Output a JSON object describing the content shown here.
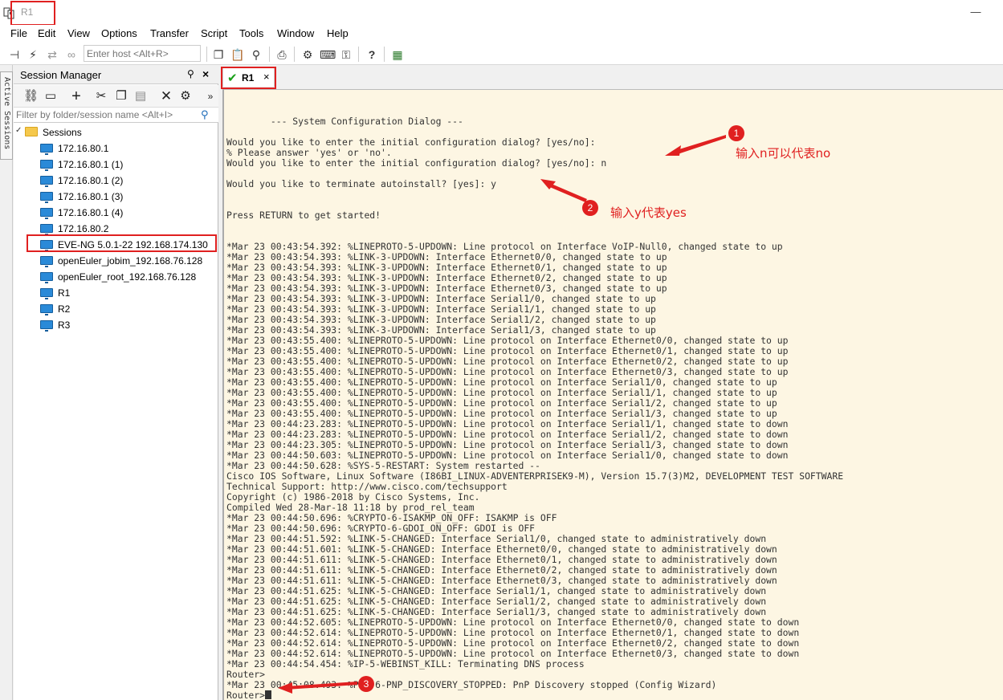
{
  "window": {
    "title": "R1",
    "minimize_glyph": "—"
  },
  "menu": [
    "File",
    "Edit",
    "View",
    "Options",
    "Transfer",
    "Script",
    "Tools",
    "Window",
    "Help"
  ],
  "toolbar": {
    "host_placeholder": "Enter host <Alt+R>"
  },
  "side_strip": {
    "label": "Active Sessions"
  },
  "session_manager": {
    "title": "Session Manager",
    "filter_placeholder": "Filter by folder/session name <Alt+I>",
    "folder": "Sessions",
    "sessions": [
      "172.16.80.1",
      "172.16.80.1 (1)",
      "172.16.80.1 (2)",
      "172.16.80.1 (3)",
      "172.16.80.1 (4)",
      "172.16.80.2",
      "EVE-NG 5.0.1-22 192.168.174.130",
      "openEuler_jobim_192.168.76.128",
      "openEuler_root_192.168.76.128",
      "R1",
      "R2",
      "R3"
    ],
    "selected_session": "EVE-NG 5.0.1-22 192.168.174.130"
  },
  "tab": {
    "label": "R1",
    "status_icon": "check-icon",
    "close_glyph": "×"
  },
  "terminal": {
    "lines": [
      "",
      "        --- System Configuration Dialog ---",
      "",
      "Would you like to enter the initial configuration dialog? [yes/no]:",
      "% Please answer 'yes' or 'no'.",
      "Would you like to enter the initial configuration dialog? [yes/no]: n",
      "",
      "Would you like to terminate autoinstall? [yes]: y",
      "",
      "",
      "Press RETURN to get started!",
      "",
      "",
      "*Mar 23 00:43:54.392: %LINEPROTO-5-UPDOWN: Line protocol on Interface VoIP-Null0, changed state to up",
      "*Mar 23 00:43:54.393: %LINK-3-UPDOWN: Interface Ethernet0/0, changed state to up",
      "*Mar 23 00:43:54.393: %LINK-3-UPDOWN: Interface Ethernet0/1, changed state to up",
      "*Mar 23 00:43:54.393: %LINK-3-UPDOWN: Interface Ethernet0/2, changed state to up",
      "*Mar 23 00:43:54.393: %LINK-3-UPDOWN: Interface Ethernet0/3, changed state to up",
      "*Mar 23 00:43:54.393: %LINK-3-UPDOWN: Interface Serial1/0, changed state to up",
      "*Mar 23 00:43:54.393: %LINK-3-UPDOWN: Interface Serial1/1, changed state to up",
      "*Mar 23 00:43:54.393: %LINK-3-UPDOWN: Interface Serial1/2, changed state to up",
      "*Mar 23 00:43:54.393: %LINK-3-UPDOWN: Interface Serial1/3, changed state to up",
      "*Mar 23 00:43:55.400: %LINEPROTO-5-UPDOWN: Line protocol on Interface Ethernet0/0, changed state to up",
      "*Mar 23 00:43:55.400: %LINEPROTO-5-UPDOWN: Line protocol on Interface Ethernet0/1, changed state to up",
      "*Mar 23 00:43:55.400: %LINEPROTO-5-UPDOWN: Line protocol on Interface Ethernet0/2, changed state to up",
      "*Mar 23 00:43:55.400: %LINEPROTO-5-UPDOWN: Line protocol on Interface Ethernet0/3, changed state to up",
      "*Mar 23 00:43:55.400: %LINEPROTO-5-UPDOWN: Line protocol on Interface Serial1/0, changed state to up",
      "*Mar 23 00:43:55.400: %LINEPROTO-5-UPDOWN: Line protocol on Interface Serial1/1, changed state to up",
      "*Mar 23 00:43:55.400: %LINEPROTO-5-UPDOWN: Line protocol on Interface Serial1/2, changed state to up",
      "*Mar 23 00:43:55.400: %LINEPROTO-5-UPDOWN: Line protocol on Interface Serial1/3, changed state to up",
      "*Mar 23 00:44:23.283: %LINEPROTO-5-UPDOWN: Line protocol on Interface Serial1/1, changed state to down",
      "*Mar 23 00:44:23.283: %LINEPROTO-5-UPDOWN: Line protocol on Interface Serial1/2, changed state to down",
      "*Mar 23 00:44:23.305: %LINEPROTO-5-UPDOWN: Line protocol on Interface Serial1/3, changed state to down",
      "*Mar 23 00:44:50.603: %LINEPROTO-5-UPDOWN: Line protocol on Interface Serial1/0, changed state to down",
      "*Mar 23 00:44:50.628: %SYS-5-RESTART: System restarted --",
      "Cisco IOS Software, Linux Software (I86BI_LINUX-ADVENTERPRISEK9-M), Version 15.7(3)M2, DEVELOPMENT TEST SOFTWARE",
      "Technical Support: http://www.cisco.com/techsupport",
      "Copyright (c) 1986-2018 by Cisco Systems, Inc.",
      "Compiled Wed 28-Mar-18 11:18 by prod_rel_team",
      "*Mar 23 00:44:50.696: %CRYPTO-6-ISAKMP_ON_OFF: ISAKMP is OFF",
      "*Mar 23 00:44:50.696: %CRYPTO-6-GDOI_ON_OFF: GDOI is OFF",
      "*Mar 23 00:44:51.592: %LINK-5-CHANGED: Interface Serial1/0, changed state to administratively down",
      "*Mar 23 00:44:51.601: %LINK-5-CHANGED: Interface Ethernet0/0, changed state to administratively down",
      "*Mar 23 00:44:51.611: %LINK-5-CHANGED: Interface Ethernet0/1, changed state to administratively down",
      "*Mar 23 00:44:51.611: %LINK-5-CHANGED: Interface Ethernet0/2, changed state to administratively down",
      "*Mar 23 00:44:51.611: %LINK-5-CHANGED: Interface Ethernet0/3, changed state to administratively down",
      "*Mar 23 00:44:51.625: %LINK-5-CHANGED: Interface Serial1/1, changed state to administratively down",
      "*Mar 23 00:44:51.625: %LINK-5-CHANGED: Interface Serial1/2, changed state to administratively down",
      "*Mar 23 00:44:51.625: %LINK-5-CHANGED: Interface Serial1/3, changed state to administratively down",
      "*Mar 23 00:44:52.605: %LINEPROTO-5-UPDOWN: Line protocol on Interface Ethernet0/0, changed state to down",
      "*Mar 23 00:44:52.614: %LINEPROTO-5-UPDOWN: Line protocol on Interface Ethernet0/1, changed state to down",
      "*Mar 23 00:44:52.614: %LINEPROTO-5-UPDOWN: Line protocol on Interface Ethernet0/2, changed state to down",
      "*Mar 23 00:44:52.614: %LINEPROTO-5-UPDOWN: Line protocol on Interface Ethernet0/3, changed state to down",
      "*Mar 23 00:44:54.454: %IP-5-WEBINST_KILL: Terminating DNS process",
      "Router>",
      "*Mar 23 00:45:08.493: %PNP-6-PNP_DISCOVERY_STOPPED: PnP Discovery stopped (Config Wizard)"
    ],
    "prompt": "Router>"
  },
  "annotations": [
    {
      "number": "1",
      "text": "输入n可以代表no"
    },
    {
      "number": "2",
      "text": "输入y代表yes"
    },
    {
      "number": "3",
      "text": ""
    }
  ],
  "colors": {
    "annotation": "#e02020",
    "terminal_bg": "#fdf6e3",
    "tab_check": "#19a019"
  }
}
